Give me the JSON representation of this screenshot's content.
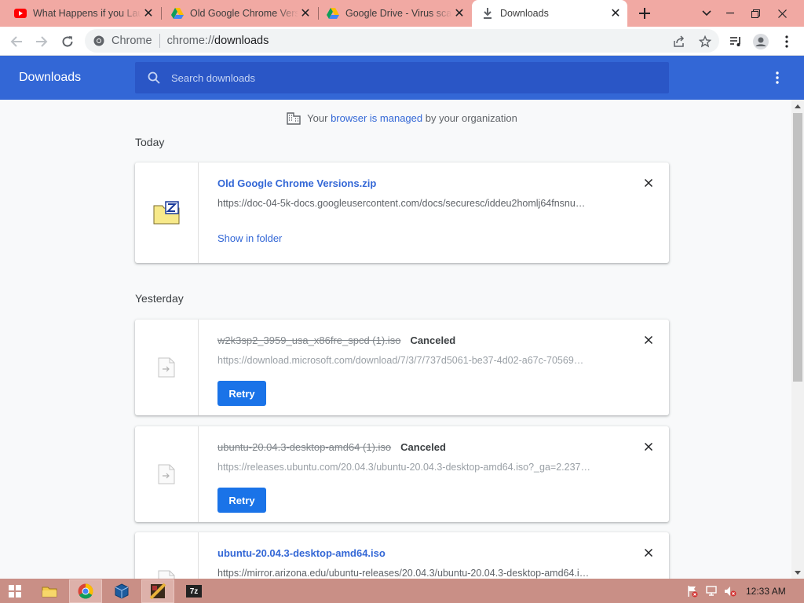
{
  "tabs": [
    {
      "title": "What Happens if you Launch",
      "favicon": "youtube-icon"
    },
    {
      "title": "Old Google Chrome Versions",
      "favicon": "google-drive-icon"
    },
    {
      "title": "Google Drive - Virus scan",
      "favicon": "google-drive-icon"
    },
    {
      "title": "Downloads",
      "favicon": "download-icon",
      "active": true
    }
  ],
  "address_bar": {
    "site_name": "Chrome",
    "url_scheme": "chrome://",
    "url_host": "downloads"
  },
  "downloads_page": {
    "title": "Downloads",
    "search_placeholder": "Search downloads",
    "managed_notice": {
      "prefix": "Your ",
      "link": "browser is managed",
      "suffix": " by your organization"
    },
    "groups": [
      {
        "label": "Today",
        "items": [
          {
            "name": "Old Google Chrome Versions.zip",
            "url": "https://doc-04-5k-docs.googleusercontent.com/docs/securesc/iddeu2homlj64fnsnu…",
            "action": "Show in folder",
            "icon": "zip-file-icon"
          }
        ]
      },
      {
        "label": "Yesterday",
        "items": [
          {
            "name": "w2k3sp2_3959_usa_x86fre_spcd (1).iso",
            "status": "Canceled",
            "url": "https://download.microsoft.com/download/7/3/7/737d5061-be37-4d02-a67c-70569…",
            "action": "Retry",
            "icon": "generic-file-icon"
          },
          {
            "name": "ubuntu-20.04.3-desktop-amd64 (1).iso",
            "status": "Canceled",
            "url": "https://releases.ubuntu.com/20.04.3/ubuntu-20.04.3-desktop-amd64.iso?_ga=2.237…",
            "action": "Retry",
            "icon": "generic-file-icon"
          },
          {
            "name": "ubuntu-20.04.3-desktop-amd64.iso",
            "url": "https://mirror.arizona.edu/ubuntu-releases/20.04.3/ubuntu-20.04.3-desktop-amd64.i…",
            "icon": "generic-file-icon"
          }
        ]
      }
    ]
  },
  "taskbar": {
    "clock": "12:33 AM",
    "apps": [
      "file-explorer-icon",
      "chrome-icon",
      "virtualbox-icon",
      "winrar-icon",
      "7zip-icon"
    ],
    "seven_zip_label": "7z"
  },
  "colors": {
    "tabstrip": "#f1a9a3",
    "header_blue": "#3367d6",
    "link_blue": "#3367d6",
    "retry_blue": "#1a73e8",
    "taskbar": "#c98f86"
  }
}
